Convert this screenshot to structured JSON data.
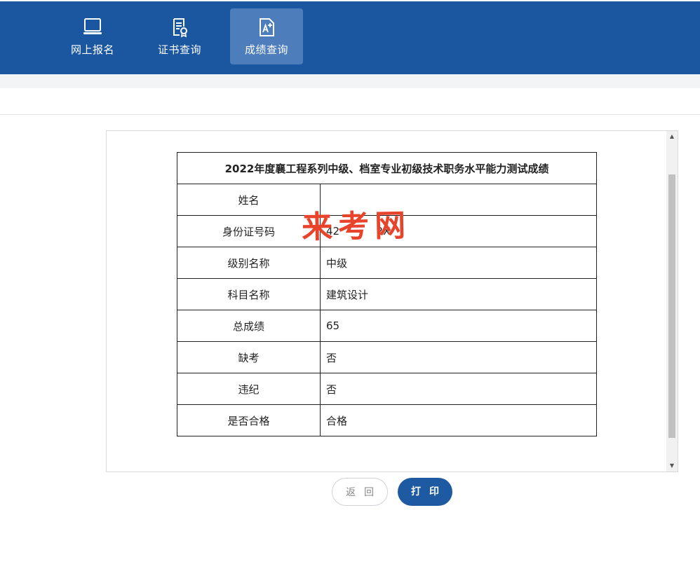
{
  "nav": {
    "items": [
      {
        "label": "网上报名",
        "icon": "laptop-icon",
        "active": false
      },
      {
        "label": "证书查询",
        "icon": "certificate-icon",
        "active": false
      },
      {
        "label": "成绩查询",
        "icon": "score-icon",
        "active": true
      }
    ]
  },
  "result": {
    "title": "2022年度襄工程系列中级、档室专业初级技术职务水平能力测试成绩",
    "rows": [
      {
        "label": "姓名",
        "value": ""
      },
      {
        "label": "身份证号码",
        "value": "42           2X"
      },
      {
        "label": "级别名称",
        "value": "中级"
      },
      {
        "label": "科目名称",
        "value": "建筑设计"
      },
      {
        "label": "总成绩",
        "value": "65"
      },
      {
        "label": "缺考",
        "value": "否"
      },
      {
        "label": "违纪",
        "value": "否"
      },
      {
        "label": "是否合格",
        "value": "合格"
      }
    ]
  },
  "watermark": "来考网",
  "buttons": {
    "back": "返回",
    "print": "打印"
  },
  "colors": {
    "header": "#1b56a0",
    "active_tab": "#4d7dbb",
    "print_button": "#1e5aa2",
    "watermark": "#e8442c"
  }
}
